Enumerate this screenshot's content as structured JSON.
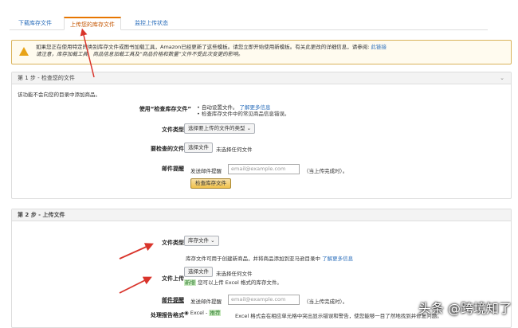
{
  "tabs": [
    {
      "label": "下载库存文件"
    },
    {
      "label": "上传您的库存文件"
    },
    {
      "label": "监控上传状态"
    }
  ],
  "alert": {
    "text": "如果您正在使用特定的类别库存文件或图书加载工具，Amazon已经更新了这些模板。请您立即开始使用新模板。有关此更改的详细信息，请参阅:",
    "link": "此链接",
    "line2": "请注意，库存加载工具、商品信息加载工具及“商品价格和数量”文件不受此次变更的影响。"
  },
  "step1": {
    "title": "第 1 步 - 检查您的文件",
    "intro": "该功能不会向您的目录中添加商品。",
    "use_label": "使用“检查库存文件”",
    "bullet1": "自动设置文件。",
    "learn_more": "了解更多信息",
    "bullet2": "检查库存文件中的常见商品信息错误。",
    "file_type_label": "文件类型",
    "file_type_value": "选择要上传的文件的类型",
    "check_file_label": "要检查的文件",
    "choose_file": "选择文件",
    "no_file": "未选择任何文件",
    "email_label": "邮件提醒",
    "email_prefix": "发送邮件提醒",
    "email_placeholder": "email@example.com",
    "email_suffix": "（当上传完成时）。",
    "check_button": "检查库存文件"
  },
  "step2": {
    "title": "第 2 步 - 上传文件",
    "file_type_label": "文件类型",
    "file_type_value": "库存文件",
    "desc": "库存文件可用于创建新商品，并将商品添加到亚马逊目录中",
    "learn_more": "了解更多信息",
    "upload_label": "文件上传",
    "choose_file": "选择文件",
    "no_file": "未选择任何文件",
    "new_badge": "新增",
    "excel_note": "您可以上传 Excel 格式的库存文件。",
    "email_label": "邮件提醒",
    "email_prefix": "发送邮件提醒",
    "email_placeholder": "email@example.com",
    "email_suffix": "（当上传完成时）。",
    "report_label": "处理报告格式",
    "option_excel": "Excel -",
    "recommended": "推荐",
    "excel_desc": "Excel 格式会在相应单元格中突出显示错误和警告，使您能够一目了然地找到并修复问题。"
  },
  "watermark": "头条 @跨境知了"
}
